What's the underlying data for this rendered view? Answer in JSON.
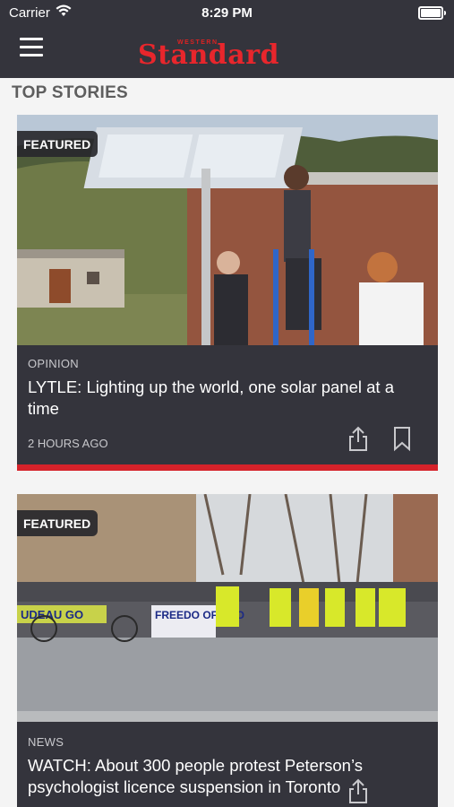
{
  "status_bar": {
    "carrier": "Carrier",
    "time": "8:29 PM"
  },
  "header": {
    "logo_small": "WESTERN",
    "logo_main": "Standard",
    "menu_icon": "hamburger-icon",
    "brand_color": "#e8262c",
    "bar_color": "#34343c"
  },
  "section": {
    "title": "TOP STORIES"
  },
  "stories": [
    {
      "badge": "FEATURED",
      "category": "OPINION",
      "headline": "LYTLE: Lighting up the world, one solar panel at a time",
      "time_ago": "2 HOURS AGO",
      "share_icon": "share-icon",
      "bookmark_icon": "bookmark-icon"
    },
    {
      "badge": "FEATURED",
      "category": "NEWS",
      "headline": "WATCH: About 300 people protest Peterson’s psychologist licence suspension in Toronto",
      "photo_banner_1": "UDEAU GO",
      "photo_banner_2": "FREEDO OF CHO",
      "share_icon": "share-icon"
    }
  ]
}
